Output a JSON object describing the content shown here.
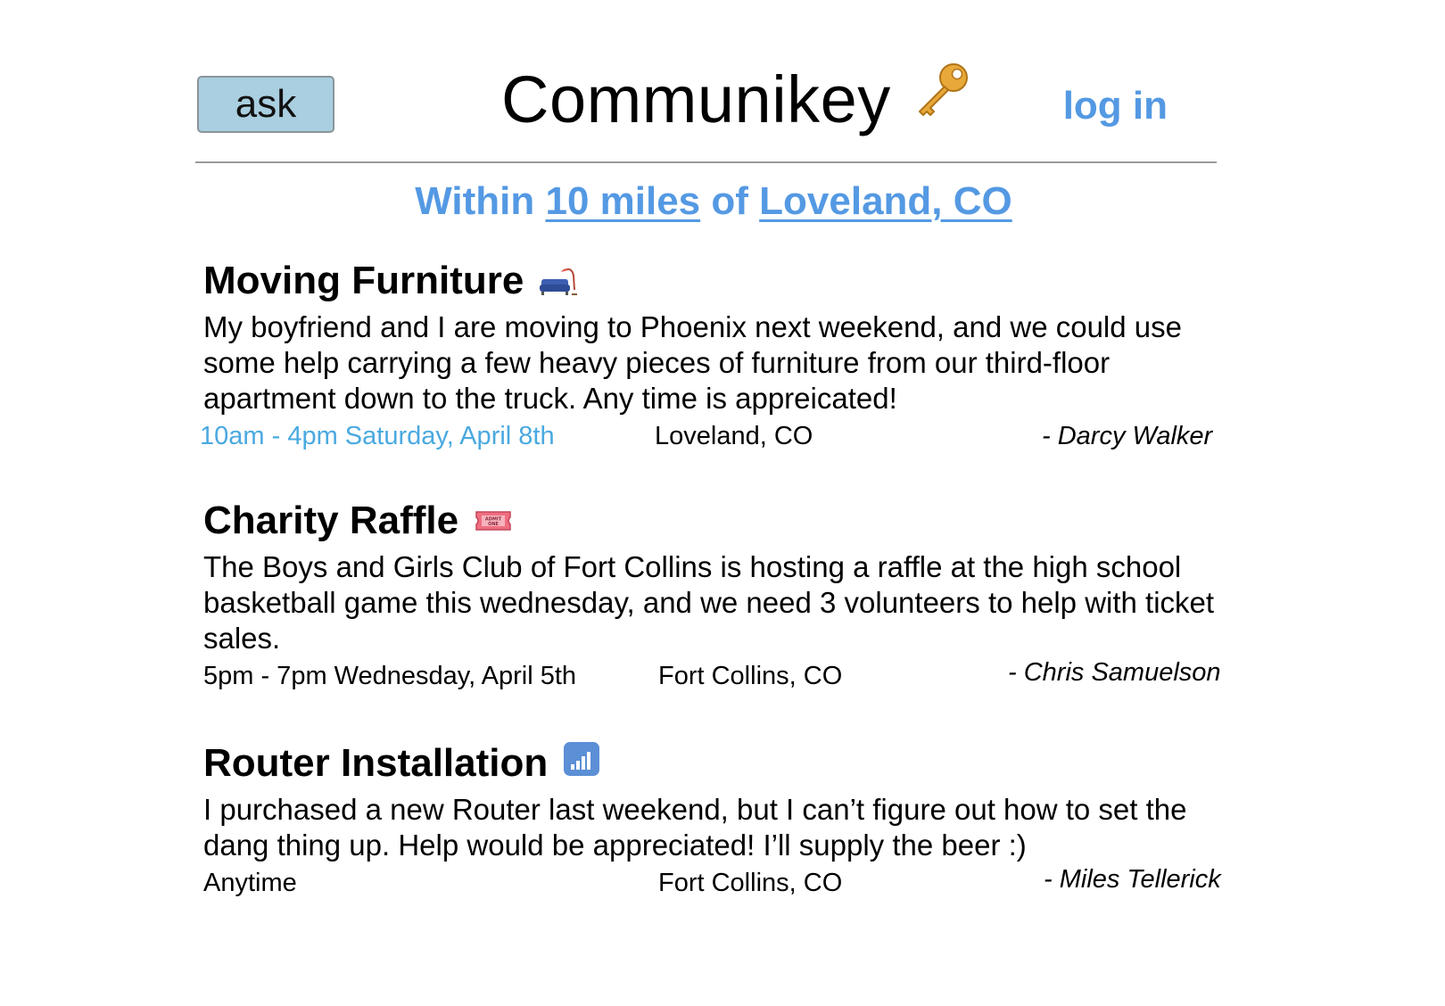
{
  "header": {
    "ask_label": "ask",
    "brand_title": "Communikey",
    "brand_icon": "key-icon",
    "login_label": "log in"
  },
  "colors": {
    "accent": "#5499e3",
    "time_highlight": "#4aa9e0",
    "ask_button_bg": "#a9cfe0",
    "divider": "#9a9a9a"
  },
  "location": {
    "prefix": "Within",
    "distance": "10 miles",
    "joiner": "of",
    "place": "Loveland, CO"
  },
  "posts": [
    {
      "title": "Moving Furniture",
      "icon": "couch-icon",
      "body": "My boyfriend and I are moving to Phoenix next weekend, and we could use some help carrying a few heavy pieces of furniture from our third-floor apartment down to the truck. Any time is appreicated!",
      "time": "10am - 4pm Saturday, April 8th",
      "place": "Loveland, CO",
      "author": "- Darcy Walker"
    },
    {
      "title": "Charity Raffle",
      "icon": "admission-ticket-icon",
      "body": "The Boys and Girls Club of Fort Collins is hosting a raffle at the high school basketball game this wednesday, and we need 3 volunteers to help with ticket sales.",
      "time": "5pm - 7pm Wednesday, April 5th",
      "place": "Fort Collins, CO",
      "author": "- Chris Samuelson"
    },
    {
      "title": "Router Installation",
      "icon": "signal-bars-icon",
      "body": "I purchased a new Router last weekend, but I can’t figure out how to set the dang thing up. Help would be appreciated! I’ll supply the beer :)",
      "time": "Anytime",
      "place": "Fort Collins, CO",
      "author": "- Miles Tellerick"
    }
  ]
}
